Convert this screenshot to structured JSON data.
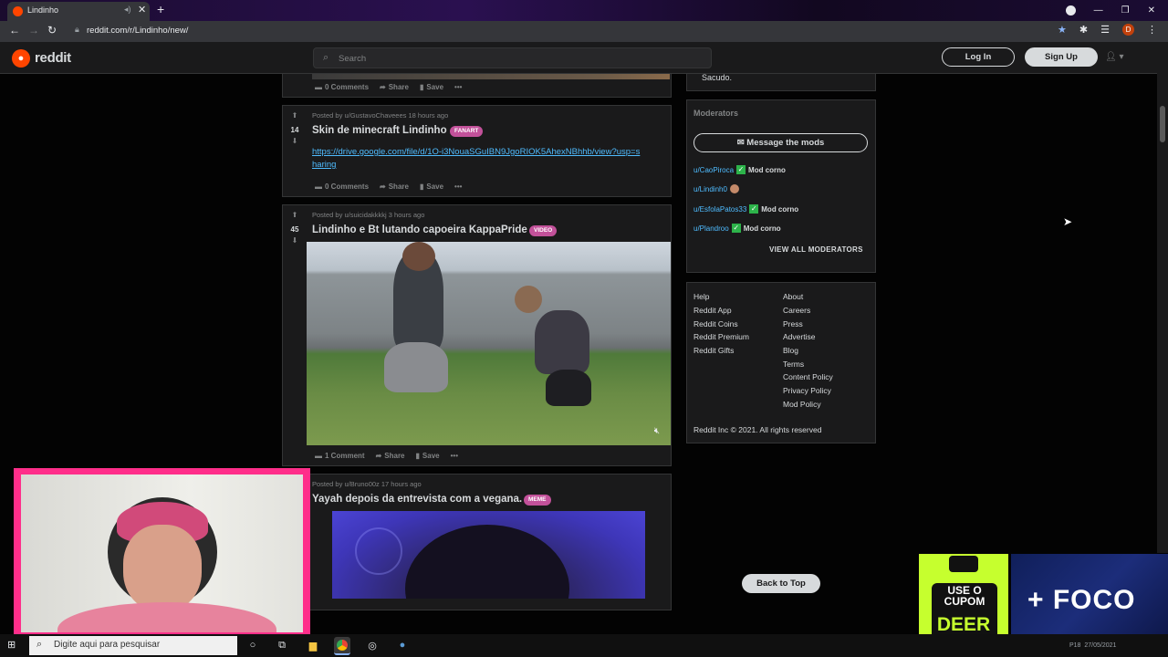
{
  "browser": {
    "tab_title": "Lindinho",
    "url": "reddit.com/r/Lindinho/new/",
    "profile_initial": "D"
  },
  "header": {
    "logo_text": "reddit",
    "search_placeholder": "Search",
    "login_label": "Log In",
    "signup_label": "Sign Up"
  },
  "posts": [
    {
      "partial_top_text": "Sacudo.",
      "comments": "0 Comments",
      "share": "Share",
      "save": "Save",
      "more": "•••"
    },
    {
      "score": "14",
      "meta": "Posted by u/GustavoChaveees 18 hours ago",
      "title": "Skin de minecraft Lindinho",
      "flair": "FANART",
      "link": "https://drive.google.com/file/d/1O-i3NouaSGuIBN9JgoRIOK5AhexNBhhb/view?usp=sharing",
      "comments": "0 Comments",
      "share": "Share",
      "save": "Save",
      "more": "•••"
    },
    {
      "score": "45",
      "meta": "Posted by u/suicidakkkkj 3 hours ago",
      "title": "Lindinho e Bt lutando capoeira KappaPride",
      "flair": "VIDEO",
      "comments": "1 Comment",
      "share": "Share",
      "save": "Save",
      "more": "•••"
    },
    {
      "meta": "Posted by u/Bruno00z 17 hours ago",
      "title": "Yayah depois da entrevista com a vegana.",
      "flair": "MEME"
    }
  ],
  "sidebar": {
    "about_tail": "Sacudo.",
    "moderators_title": "Moderators",
    "message_mods": "Message the mods",
    "mods": [
      {
        "name": "u/CaoPiroca",
        "flair": "Mod corno"
      },
      {
        "name": "u/Lindinh0",
        "flair": ""
      },
      {
        "name": "u/EsfolaPatos33",
        "flair": "Mod corno"
      },
      {
        "name": "u/Plandroo",
        "flair": "Mod corno"
      }
    ],
    "view_all": "VIEW ALL MODERATORS",
    "footer_left": [
      "Help",
      "Reddit App",
      "Reddit Coins",
      "Reddit Premium",
      "Reddit Gifts"
    ],
    "footer_right": [
      "About",
      "Careers",
      "Press",
      "Advertise",
      "Blog",
      "Terms",
      "Content Policy",
      "Privacy Policy",
      "Mod Policy"
    ],
    "copyright": "Reddit Inc © 2021. All rights reserved",
    "back_to_top": "Back to Top"
  },
  "promo": {
    "coupon_line1": "USE O",
    "coupon_line2": "CUPOM",
    "coupon_code": "DEER",
    "brand": "+ FOCO"
  },
  "taskbar": {
    "search_placeholder": "Digite aqui para pesquisar",
    "clock_time": "P18",
    "clock_date": "27/05/2021"
  },
  "colors": {
    "accent": "#ff4500",
    "flair": "#c2519a",
    "link": "#4fbcff",
    "webcam_frame": "#ff2e8a",
    "promo_green": "#c6ff2e"
  }
}
